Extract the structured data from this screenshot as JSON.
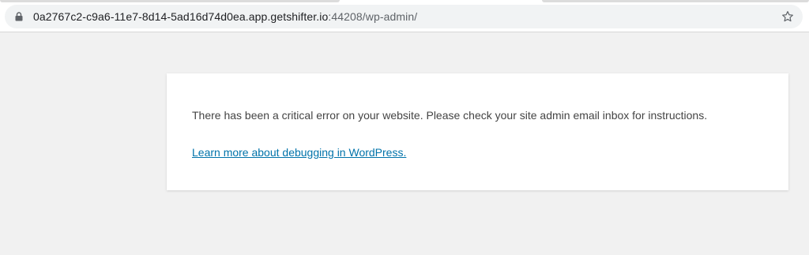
{
  "browser": {
    "url_host": "0a2767c2-c9a6-11e7-8d14-5ad16d74d0ea.app.getshifter.io",
    "url_rest": ":44208/wp-admin/",
    "lock_icon": "lock-icon",
    "bookmark_icon": "star-icon"
  },
  "error": {
    "message": "There has been a critical error on your website. Please check your site admin email inbox for instructions.",
    "link_text": "Learn more about debugging in WordPress."
  },
  "colors": {
    "page_background": "#f1f1f1",
    "card_background": "#ffffff",
    "text": "#444444",
    "link": "#0073aa"
  }
}
